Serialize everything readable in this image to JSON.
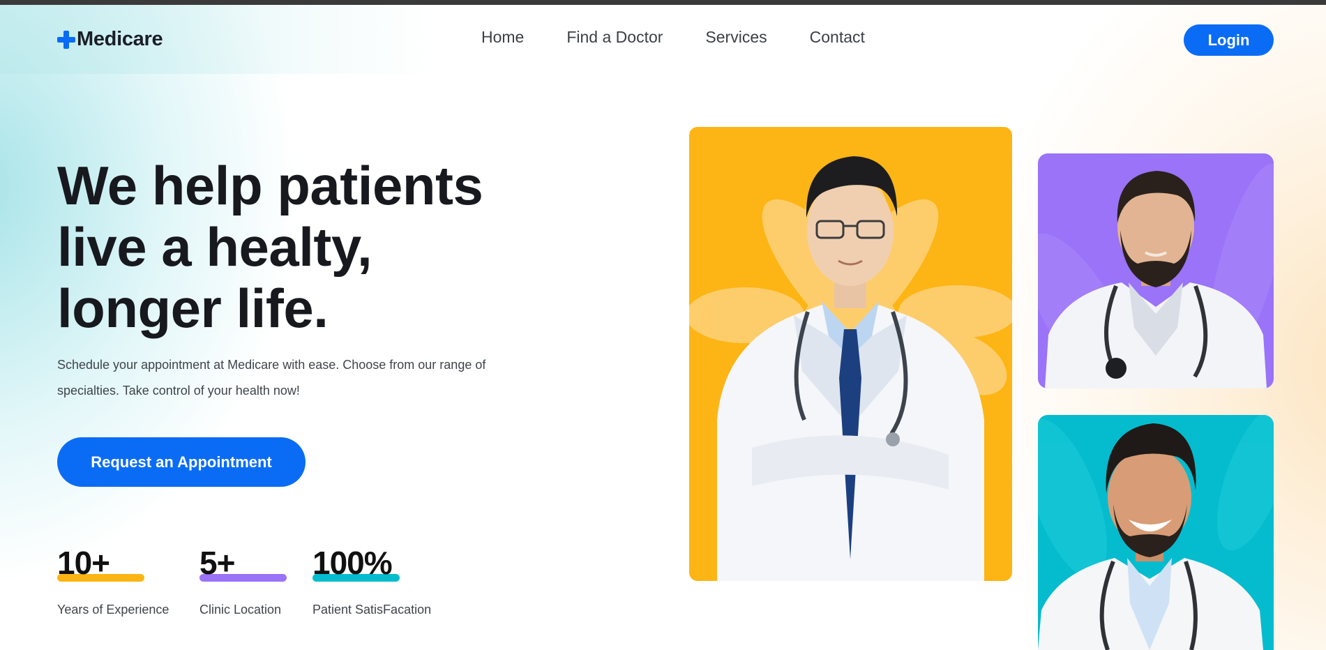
{
  "brand": {
    "name": "Medicare",
    "accent": "#0a6cf5"
  },
  "nav": {
    "items": [
      {
        "label": "Home"
      },
      {
        "label": "Find a Doctor"
      },
      {
        "label": "Services"
      },
      {
        "label": "Contact"
      }
    ],
    "login_label": "Login"
  },
  "hero": {
    "title_lines": [
      "We help patients",
      "live a healty,",
      "longer life."
    ],
    "description": "Schedule your appointment at Medicare with ease. Choose from our range of specialties. Take control of your health now!",
    "cta_label": "Request an Appointment"
  },
  "stats": [
    {
      "value": "10+",
      "label": "Years of Experience",
      "color": "#fdb515"
    },
    {
      "value": "5+",
      "label": "Clinic Location",
      "color": "#9a73f8"
    },
    {
      "value": "100%",
      "label": "Patient SatisFacation",
      "color": "#04bcce"
    }
  ],
  "doctor_cards": [
    {
      "background": "#fdb515"
    },
    {
      "background": "#9a73f8"
    },
    {
      "background": "#04bcce"
    }
  ]
}
